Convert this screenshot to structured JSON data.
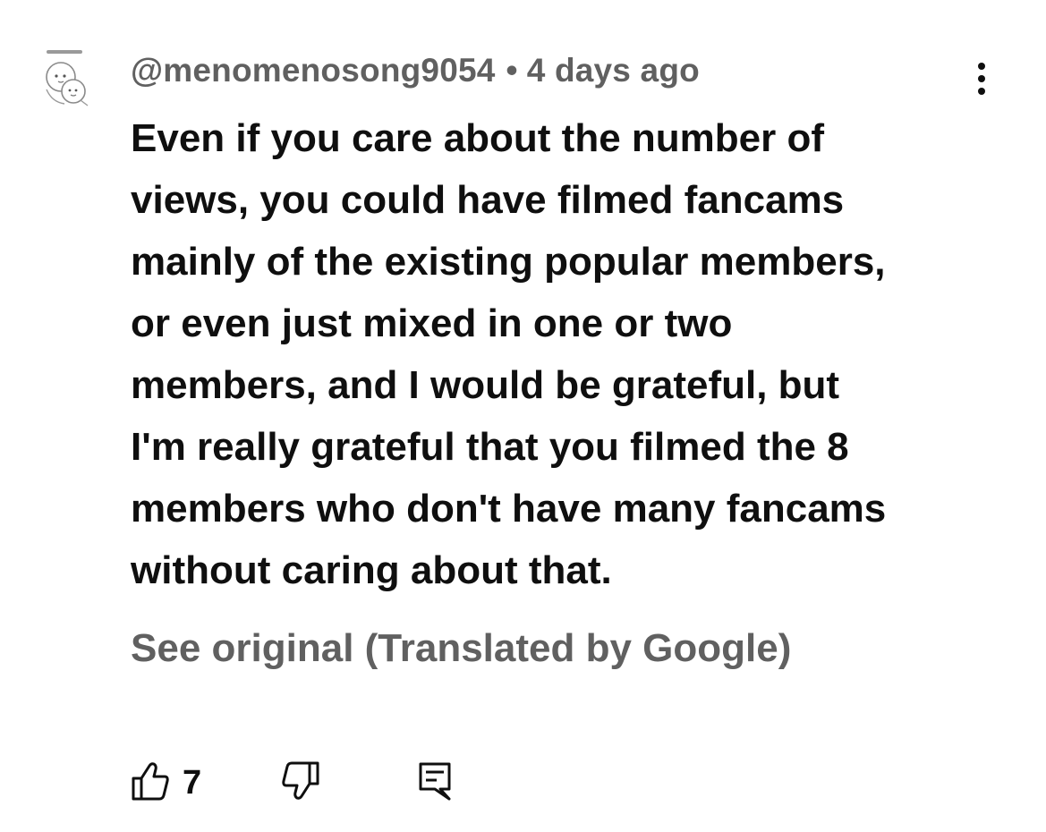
{
  "comment": {
    "author": "@menomenosong9054",
    "separator": "•",
    "timestamp": "4 days ago",
    "avatar_icon": "cartoon-character-avatar",
    "body_lines": [
      "Even if you care about the number of",
      "views, you could have filmed fancams",
      "mainly of the existing popular members,",
      "or even just mixed in one or two",
      "members, and I would be grateful, but",
      "I'm really grateful that you filmed the 8",
      "members who don't have many fancams",
      "without caring about that."
    ],
    "translation_link": "See original (Translated by Google)",
    "like_count": "7"
  },
  "icons": {
    "more": "vertical-ellipsis-icon",
    "like": "thumbs-up-icon",
    "dislike": "thumbs-down-icon",
    "reply": "comment-reply-icon"
  },
  "colors": {
    "text_primary": "#0f0f0f",
    "text_secondary": "#606060",
    "background": "#ffffff"
  }
}
